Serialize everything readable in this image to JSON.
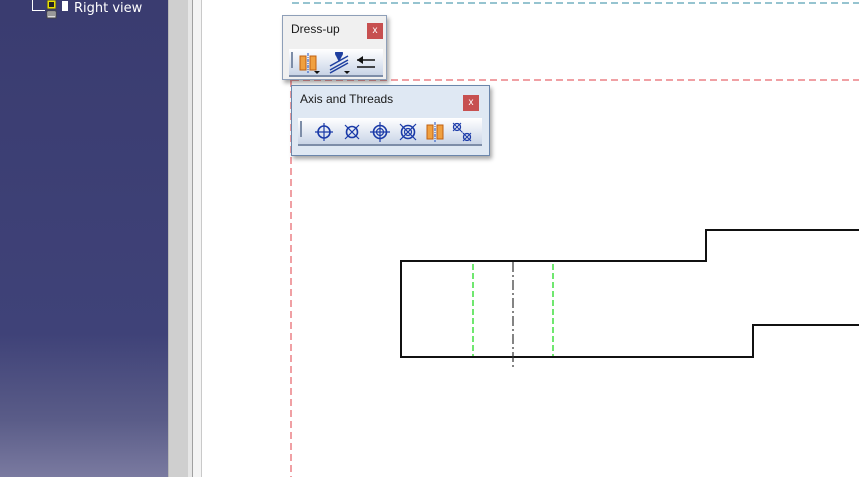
{
  "tree": {
    "items": [
      {
        "label": "Right view",
        "icon": "view-icon"
      }
    ]
  },
  "toolbars": {
    "dressup": {
      "title": "Dress-up",
      "close_label": "x",
      "buttons": [
        "axis-line-icon",
        "area-fill-icon",
        "arrow-icon"
      ]
    },
    "axis_threads": {
      "title": "Axis and Threads",
      "close_label": "x",
      "buttons": [
        "center-line-icon",
        "center-line-with-reference-icon",
        "thread-icon",
        "thread-with-reference-icon",
        "axis-line-icon",
        "axis-line-and-center-line-icon"
      ]
    }
  },
  "colors": {
    "tree_bg": "#3f4278",
    "frame_red": "#e0404a",
    "frame_teal": "#2c8aa0",
    "hidden_green": "#33dd33",
    "axis_dark": "#333333",
    "close_red": "#c75050"
  }
}
